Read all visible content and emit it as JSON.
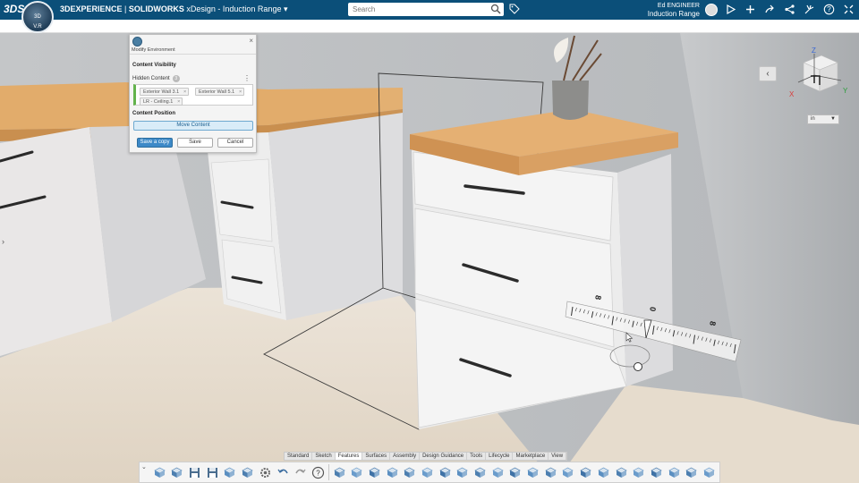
{
  "topbar": {
    "brand": "3DS",
    "compass_labels": [
      "3D",
      "V.R"
    ],
    "title_platform": "3DEXPERIENCE",
    "title_separator": " | ",
    "title_app": "SOLIDWORKS",
    "title_doc": "xDesign - Induction Range",
    "search_placeholder": "Search",
    "user_name": "Ed ENGINEER",
    "user_context": "Induction Range",
    "icons": [
      "search-icon",
      "tag-icon",
      "avatar",
      "play-icon",
      "plus-icon",
      "share-arrow-icon",
      "network-icon",
      "tools-icon",
      "help-icon",
      "expand-icon"
    ]
  },
  "dialog": {
    "title": "Modify Environment",
    "section_visibility": "Content Visibility",
    "hidden_label": "Hidden Content",
    "hidden_count": "3",
    "chips": [
      "Exterior Wall 3.1",
      "Exterior Wall 5.1",
      "LR - Ceiling.1"
    ],
    "chip_close": "×",
    "section_position": "Content Position",
    "move_label": "Move Content",
    "save_copy_label": "Save a copy",
    "save_label": "Save",
    "cancel_label": "Cancel",
    "close_glyph": "×"
  },
  "viewport": {
    "back_glyph": "‹",
    "unit": "in",
    "unit_arrow": "▼",
    "left_arrow": "›",
    "axis_labels": {
      "z": "Z",
      "x": "X",
      "y": "Y"
    },
    "ruler_labels": [
      "8",
      "0",
      "8"
    ]
  },
  "tabs": [
    "Standard",
    "Sketch",
    "Features",
    "Surfaces",
    "Assembly",
    "Design Guidance",
    "Tools",
    "Lifecycle",
    "Marketplace",
    "View"
  ],
  "active_tab": "Features",
  "toolbar": {
    "toggle": "⌄",
    "groups": [
      [
        "new-part-icon",
        "new-assembly-icon",
        "save-icon",
        "save-as-icon",
        "revision-icon",
        "properties-icon",
        "settings-icon",
        "undo-icon",
        "redo-icon",
        "help-icon"
      ],
      [
        "extrude-icon",
        "extrude-cut-icon",
        "revolve-icon",
        "sweep-icon",
        "loft-icon",
        "shell-icon",
        "fillet-icon",
        "chamfer-icon",
        "draft-icon",
        "rib-icon",
        "mirror-icon",
        "pattern-icon",
        "hole-icon",
        "thread-icon",
        "boolean-icon",
        "split-icon",
        "move-face-icon",
        "delete-face-icon",
        "offset-icon",
        "wrap-icon",
        "emboss-icon",
        "thicken-icon"
      ]
    ]
  },
  "colors": {
    "topbar": "#0b4f79",
    "accent": "#3d89c7",
    "countertop": "#e2ac6b",
    "cabinet": "#e8e8e8",
    "wall": "#bfc2c5",
    "floor": "#e7ddcf"
  }
}
